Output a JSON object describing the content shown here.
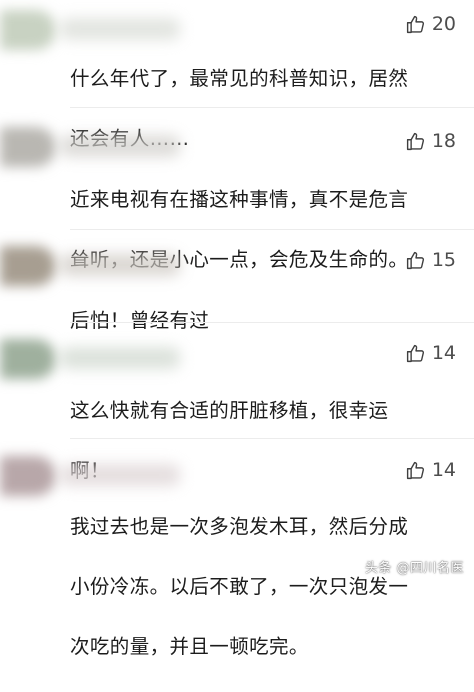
{
  "comments": [
    {
      "likes": "20",
      "lines": [
        "什么年代了，最常见的科普知识，居然",
        "还会有人……"
      ],
      "avatar_color": "#c8d2c2",
      "name_color": "#d9dcd6"
    },
    {
      "likes": "18",
      "lines": [
        "近来电视有在播这种事情，真不是危言",
        "耸听，还是小心一点，会危及生命的。"
      ],
      "avatar_color": "#b9b7b2",
      "name_color": "#d2d0cc"
    },
    {
      "likes": "15",
      "lines": [
        "后怕！曾经有过"
      ],
      "avatar_color": "#a79e91",
      "name_color": "#cfcac4"
    },
    {
      "likes": "14",
      "lines": [
        "这么快就有合适的肝脏移植，很幸运",
        "啊！"
      ],
      "avatar_color": "#9fb09e",
      "name_color": "#d0d8cf"
    },
    {
      "likes": "14",
      "lines": [
        "我过去也是一次多泡发木耳，然后分成",
        "小份冷冻。以后不敢了，一次只泡发一",
        "次吃的量，并且一顿吃完。"
      ],
      "avatar_color": "#b8a7a9",
      "name_color": "#dcd3d4"
    }
  ],
  "icons": {
    "like": "thumbs-up-outline-icon"
  },
  "watermark": "头条 @四川名医"
}
